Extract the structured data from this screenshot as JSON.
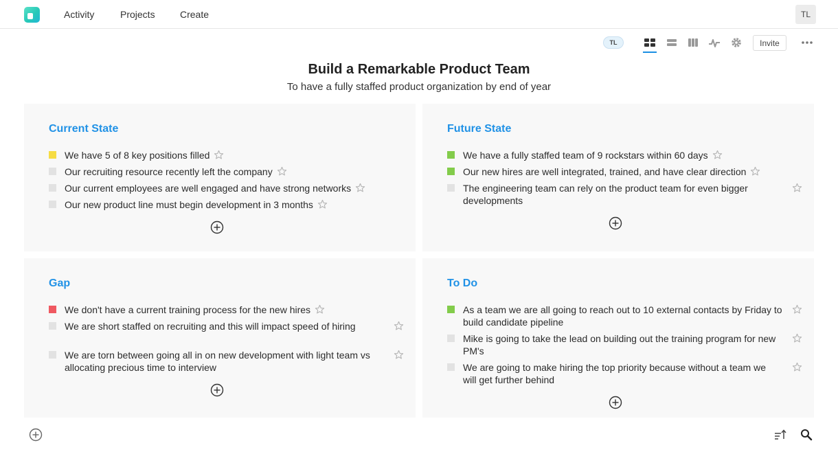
{
  "nav": {
    "items": [
      "Activity",
      "Projects",
      "Create"
    ],
    "user_initials": "TL"
  },
  "toolbar": {
    "member_initials": "TL",
    "icons": [
      "grid-view-icon",
      "list-view-icon",
      "board-view-icon",
      "activity-icon",
      "gear-icon"
    ],
    "invite_label": "Invite",
    "more_icon": "more-icon"
  },
  "page": {
    "title": "Build a Remarkable Product Team",
    "subtitle": "To have a fully staffed product organization by end of year"
  },
  "panels": {
    "current": {
      "title": "Current State",
      "items": [
        {
          "text": "We have 5 of 8 key positions filled",
          "color": "#f6dc44"
        },
        {
          "text": "Our recruiting resource recently left the company",
          "color": "#e2e2e2"
        },
        {
          "text": "Our current employees are well engaged and have strong networks",
          "color": "#e2e2e2"
        },
        {
          "text": "Our new product line must begin development in 3 months",
          "color": "#e2e2e2"
        }
      ]
    },
    "future": {
      "title": "Future State",
      "items": [
        {
          "text": "We have a fully staffed team of 9 rockstars within 60 days",
          "color": "#83cc4b"
        },
        {
          "text": "Our new hires are well integrated, trained, and have clear direction",
          "color": "#83cc4b"
        },
        {
          "text": "The engineering team can rely on the product team for even bigger developments",
          "color": "#e2e2e2"
        }
      ]
    },
    "gap": {
      "title": "Gap",
      "items": [
        {
          "text": "We don't have a current training process for the new hires",
          "color": "#ef5961"
        },
        {
          "text": "We are short staffed on recruiting and this will impact speed of hiring",
          "color": "#e2e2e2"
        },
        {
          "text": "We are torn between going all in on new development with light team vs allocating precious time to interview",
          "color": "#e2e2e2"
        }
      ]
    },
    "todo": {
      "title": "To Do",
      "items": [
        {
          "text": "As a team we are all going to reach out to 10 external contacts by Friday to build candidate pipeline",
          "color": "#83cc4b"
        },
        {
          "text": "Mike is going to take the lead on building out the training program for new PM's",
          "color": "#e2e2e2"
        },
        {
          "text": "We are going to make hiring the top priority because without a team we will get further behind",
          "color": "#e2e2e2"
        }
      ]
    }
  },
  "colors": {
    "accent": "#2192e6",
    "panel_bg": "#f8f8f8",
    "status_yellow": "#f6dc44",
    "status_green": "#83cc4b",
    "status_red": "#ef5961",
    "status_gray": "#e2e2e2"
  }
}
